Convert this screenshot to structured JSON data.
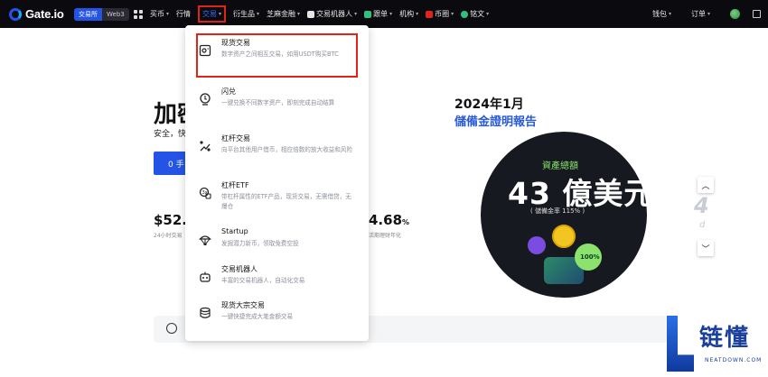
{
  "brand": {
    "logo_text": "Gate.io"
  },
  "mode_toggle": {
    "exchange": "交易所",
    "web3": "Web3"
  },
  "nav": {
    "items": [
      {
        "label": "买币",
        "caret": "▾"
      },
      {
        "label": "行情",
        "caret": ""
      },
      {
        "label": "交易",
        "caret": "▾"
      },
      {
        "label": "衍生品",
        "caret": "▾"
      },
      {
        "label": "芝麻金融",
        "caret": "▾"
      },
      {
        "label": "交易机器人",
        "caret": "▾"
      },
      {
        "label": "跟单",
        "caret": "▾"
      },
      {
        "label": "机构",
        "caret": "▾"
      },
      {
        "label": "币圈",
        "caret": "▾"
      },
      {
        "label": "铭文",
        "caret": "▾"
      }
    ],
    "right": [
      {
        "label": "钱包",
        "caret": "▾"
      },
      {
        "label": "订单",
        "caret": "▾"
      }
    ]
  },
  "hero": {
    "title": "加密",
    "subtitle": "安全，快",
    "button": "0 手"
  },
  "stats": {
    "left_value": "$52.",
    "left_label": "24小时交易",
    "mid_value": "4.68",
    "mid_unit": "%",
    "mid_label": "活期理财年化"
  },
  "report": {
    "year": "2024年1月",
    "title": "儲備金證明報告",
    "circle_label": "資產總額",
    "circle_number": "43 億美元",
    "circle_ratio": "( 儲備金率 115% )",
    "coin_text": "100%"
  },
  "carousel": {
    "up": "︿",
    "down": "﹀",
    "digit": "4",
    "small_digit": "d"
  },
  "dropdown": {
    "items": [
      {
        "title": "现货交易",
        "desc": "数字资产之间相互交易，如用USDT购买BTC"
      },
      {
        "title": "闪兑",
        "desc": "一键兑换不同数字资产，即刻完成自动结算"
      },
      {
        "title": "杠杆交易",
        "desc": "向平台其他用户借币，相应倍数的放大收益和风险"
      },
      {
        "title": "杠杆ETF",
        "desc": "带杠杆属性的ETF产品，现货交易，无需借贷，无爆仓"
      },
      {
        "title": "Startup",
        "desc": "发掘潜力新币，领取免费空投"
      },
      {
        "title": "交易机器人",
        "desc": "丰富的交易机器人，自动化交易"
      },
      {
        "title": "现货大宗交易",
        "desc": "一键快捷完成大笔金额交易"
      }
    ]
  },
  "watermark": {
    "text": "链懂",
    "sub": "NEATDOWN.COM"
  },
  "colors": {
    "accent": "#2354e6",
    "highlight": "#e2231a",
    "nav_bg": "#0b0b0f"
  }
}
